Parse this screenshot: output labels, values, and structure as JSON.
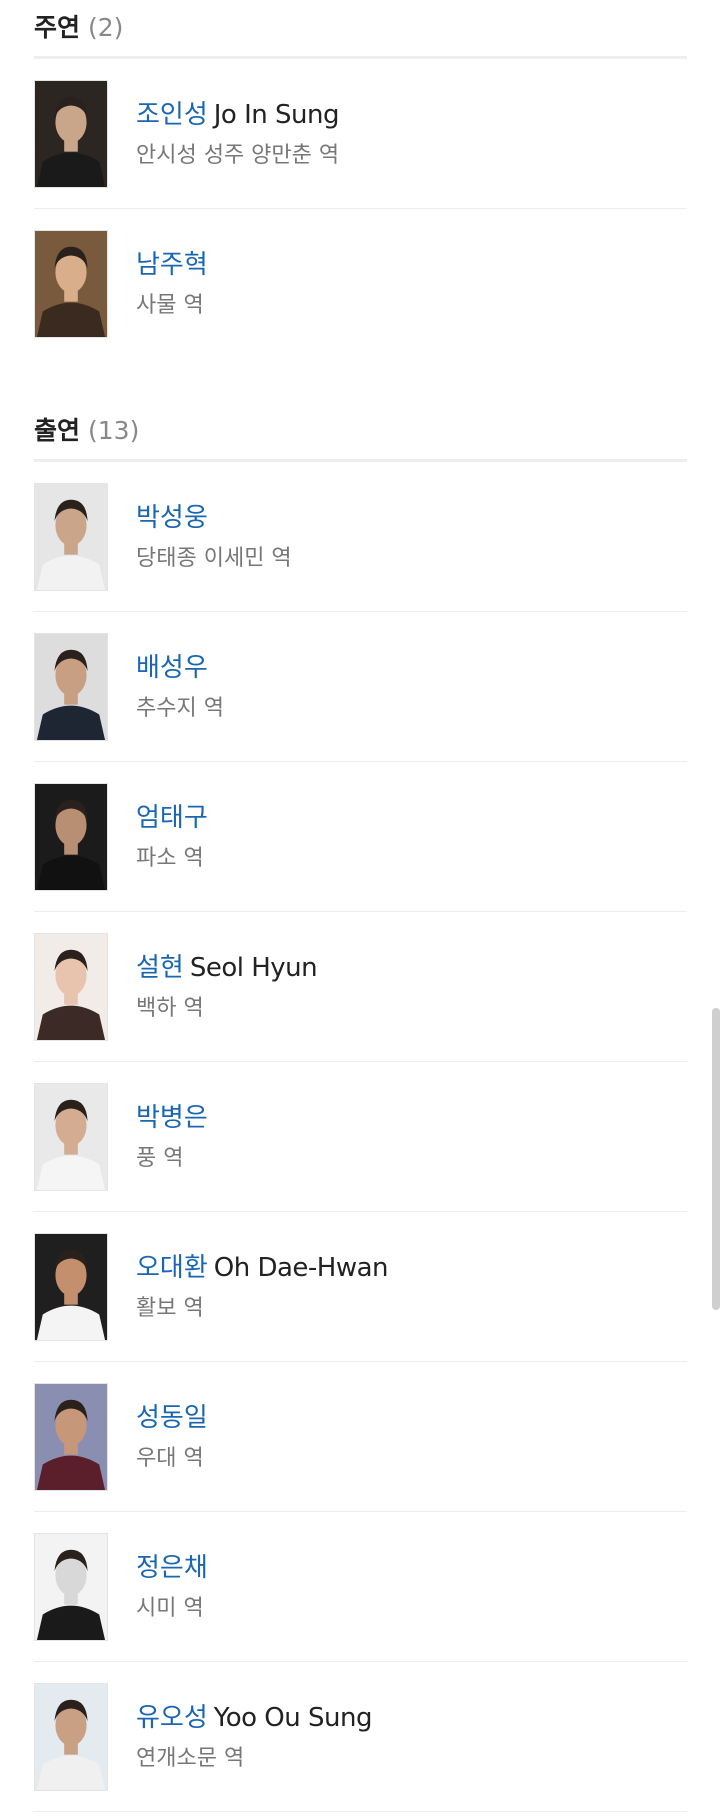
{
  "sections": [
    {
      "title": "주연",
      "count": "(2)",
      "members": [
        {
          "name_ko": "조인성",
          "name_en": "Jo In Sung",
          "role": "안시성 성주 양만춘 역",
          "photo_bg": "#2b2622",
          "photo_face": "#c9a68a",
          "photo_cloth": "#1a1a1a"
        },
        {
          "name_ko": "남주혁",
          "name_en": "",
          "role": "사물 역",
          "photo_bg": "#7a5a3c",
          "photo_face": "#d9ae8a",
          "photo_cloth": "#3a2a20"
        }
      ]
    },
    {
      "title": "출연",
      "count": "(13)",
      "members": [
        {
          "name_ko": "박성웅",
          "name_en": "",
          "role": "당태종 이세민 역",
          "photo_bg": "#e6e6e6",
          "photo_face": "#caa58a",
          "photo_cloth": "#f2f2f2"
        },
        {
          "name_ko": "배성우",
          "name_en": "",
          "role": "추수지 역",
          "photo_bg": "#dddddd",
          "photo_face": "#c99f84",
          "photo_cloth": "#1e2533"
        },
        {
          "name_ko": "엄태구",
          "name_en": "",
          "role": "파소 역",
          "photo_bg": "#1b1b1b",
          "photo_face": "#b98f73",
          "photo_cloth": "#111111"
        },
        {
          "name_ko": "설현",
          "name_en": "Seol Hyun",
          "role": "백하 역",
          "photo_bg": "#f1ece8",
          "photo_face": "#e8c3ad",
          "photo_cloth": "#3b2a26"
        },
        {
          "name_ko": "박병은",
          "name_en": "",
          "role": "풍 역",
          "photo_bg": "#e9e9e9",
          "photo_face": "#d3ac92",
          "photo_cloth": "#f5f5f5"
        },
        {
          "name_ko": "오대환",
          "name_en": "Oh Dae-Hwan",
          "role": "활보 역",
          "photo_bg": "#1f1f1f",
          "photo_face": "#c48f6c",
          "photo_cloth": "#f4f4f4"
        },
        {
          "name_ko": "성동일",
          "name_en": "",
          "role": "우대 역",
          "photo_bg": "#8a8fb1",
          "photo_face": "#c7977a",
          "photo_cloth": "#5a1f2a"
        },
        {
          "name_ko": "정은채",
          "name_en": "",
          "role": "시미 역",
          "photo_bg": "#f3f3f3",
          "photo_face": "#d8d8d8",
          "photo_cloth": "#1a1a1a"
        },
        {
          "name_ko": "유오성",
          "name_en": "Yoo Ou Sung",
          "role": "연개소문 역",
          "photo_bg": "#e3eaf0",
          "photo_face": "#c9a083",
          "photo_cloth": "#f0f0f0"
        }
      ]
    }
  ],
  "colors": {
    "name_link": "#1a66b3",
    "role_text": "#777777",
    "divider": "#eeeeee"
  }
}
